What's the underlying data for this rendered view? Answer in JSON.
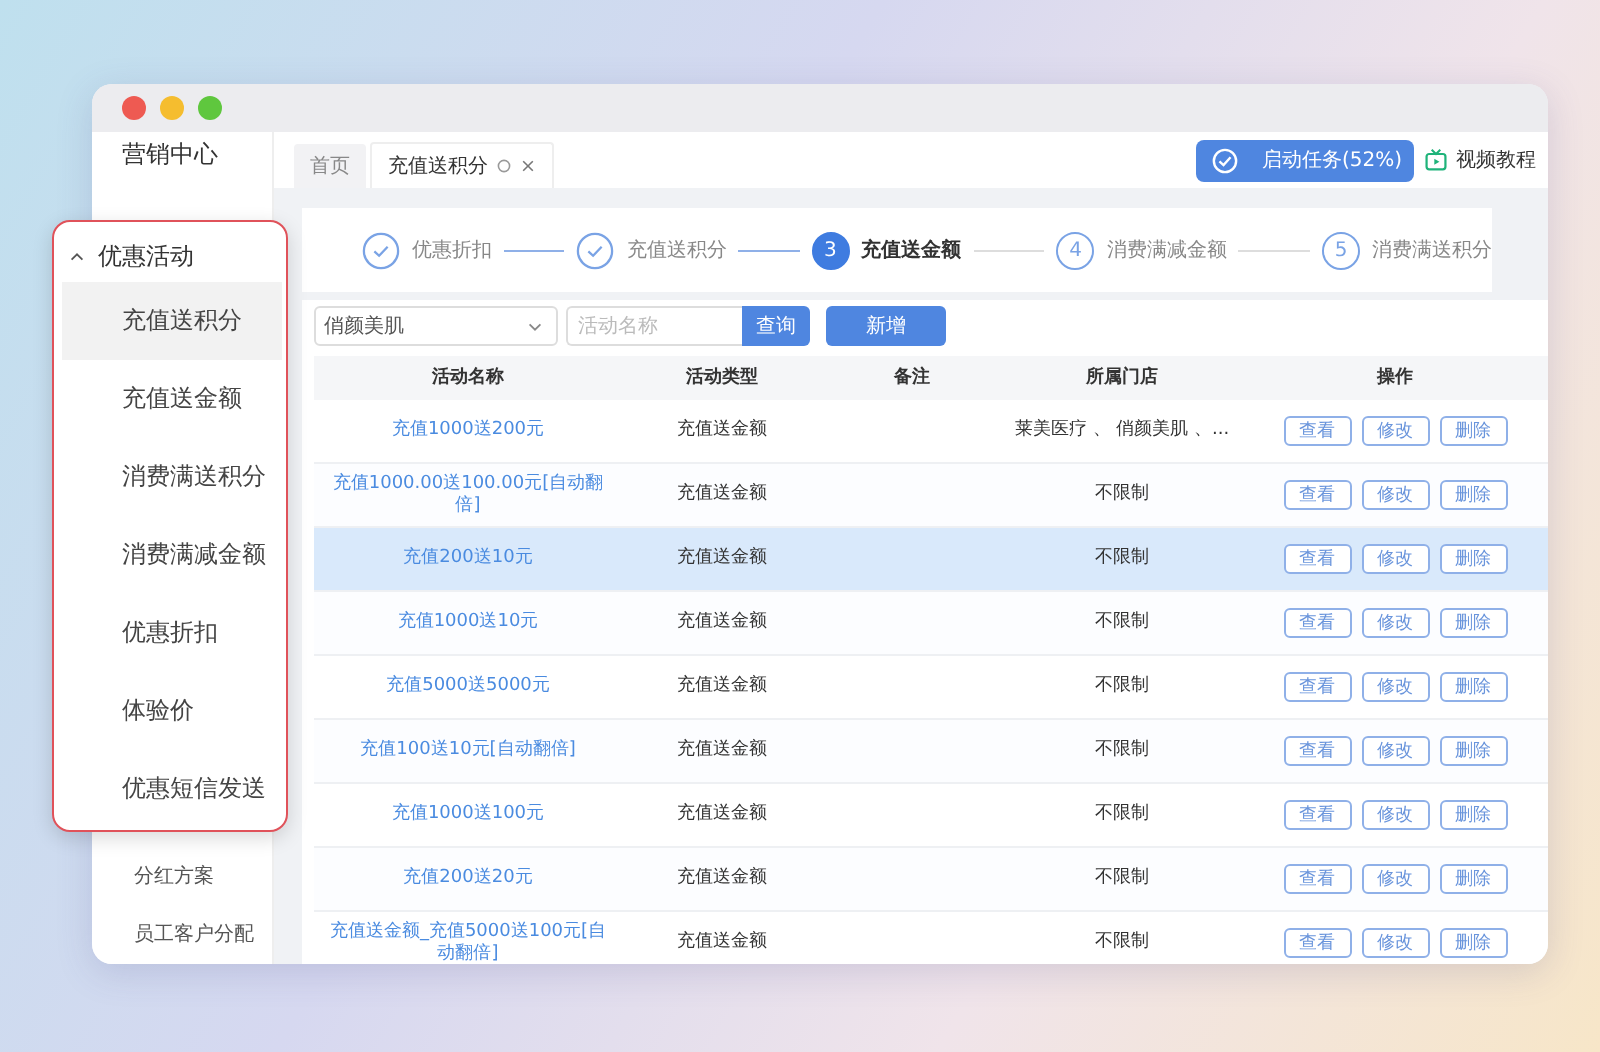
{
  "sidebar": {
    "title": "营销中心",
    "items": [
      {
        "label": "分红方案"
      },
      {
        "label": "员工客户分配"
      }
    ]
  },
  "menu_popup": {
    "title": "优惠活动",
    "expanded": true,
    "items": [
      {
        "label": "充值送积分",
        "selected": true
      },
      {
        "label": "充值送金额",
        "selected": false
      },
      {
        "label": "消费满送积分",
        "selected": false
      },
      {
        "label": "消费满减金额",
        "selected": false
      },
      {
        "label": "优惠折扣",
        "selected": false
      },
      {
        "label": "体验价",
        "selected": false
      },
      {
        "label": "优惠短信发送",
        "selected": false
      }
    ]
  },
  "tabs": [
    {
      "label": "首页",
      "selected": false,
      "closable": false
    },
    {
      "label": "充值送积分",
      "selected": true,
      "closable": true
    }
  ],
  "task_button": "启动任务(52%)",
  "video_link": "视频教程",
  "steps": [
    {
      "label": "优惠折扣",
      "done": true,
      "selected": false
    },
    {
      "label": "充值送积分",
      "done": true,
      "selected": false
    },
    {
      "number": "3",
      "label": "充值送金额",
      "done": false,
      "selected": true
    },
    {
      "number": "4",
      "label": "消费满减金额",
      "done": false,
      "selected": false
    },
    {
      "number": "5",
      "label": "消费满送积分",
      "done": false,
      "selected": false
    }
  ],
  "filter": {
    "store_select": "俏颜美肌",
    "name_placeholder": "活动名称",
    "search_button": "查询",
    "add_button": "新增"
  },
  "table": {
    "columns": [
      "活动名称",
      "活动类型",
      "备注",
      "所属门店",
      "操作"
    ],
    "rows": [
      {
        "name": "充值1000送200元",
        "type": "充值送金额",
        "store": "莱美医疗 、 俏颜美肌 、...",
        "actions": [
          "查看",
          "修改",
          "删除"
        ],
        "selected": false
      },
      {
        "name": "充值1000.00送100.00元[自动翻倍]",
        "type": "充值送金额",
        "store": "不限制",
        "actions": [
          "查看",
          "修改",
          "删除"
        ],
        "selected": false
      },
      {
        "name": "充值200送10元",
        "type": "充值送金额",
        "store": "不限制",
        "actions": [
          "查看",
          "修改",
          "删除"
        ],
        "selected": true
      },
      {
        "name": "充值1000送10元",
        "type": "充值送金额",
        "store": "不限制",
        "actions": [
          "查看",
          "修改",
          "删除"
        ],
        "selected": false
      },
      {
        "name": "充值5000送5000元",
        "type": "充值送金额",
        "store": "不限制",
        "actions": [
          "查看",
          "修改",
          "删除"
        ],
        "selected": false
      },
      {
        "name": "充值100送10元[自动翻倍]",
        "type": "充值送金额",
        "store": "不限制",
        "actions": [
          "查看",
          "修改",
          "删除"
        ],
        "selected": false
      },
      {
        "name": "充值1000送100元",
        "type": "充值送金额",
        "store": "不限制",
        "actions": [
          "查看",
          "修改",
          "删除"
        ],
        "selected": false
      },
      {
        "name": "充值200送20元",
        "type": "充值送金额",
        "store": "不限制",
        "actions": [
          "查看",
          "修改",
          "删除"
        ],
        "selected": false
      },
      {
        "name": "充值送金额_充值5000送100元[自动翻倍]",
        "type": "充值送金额",
        "store": "不限制",
        "actions": [
          "查看",
          "修改",
          "删除"
        ],
        "selected": false
      }
    ]
  }
}
